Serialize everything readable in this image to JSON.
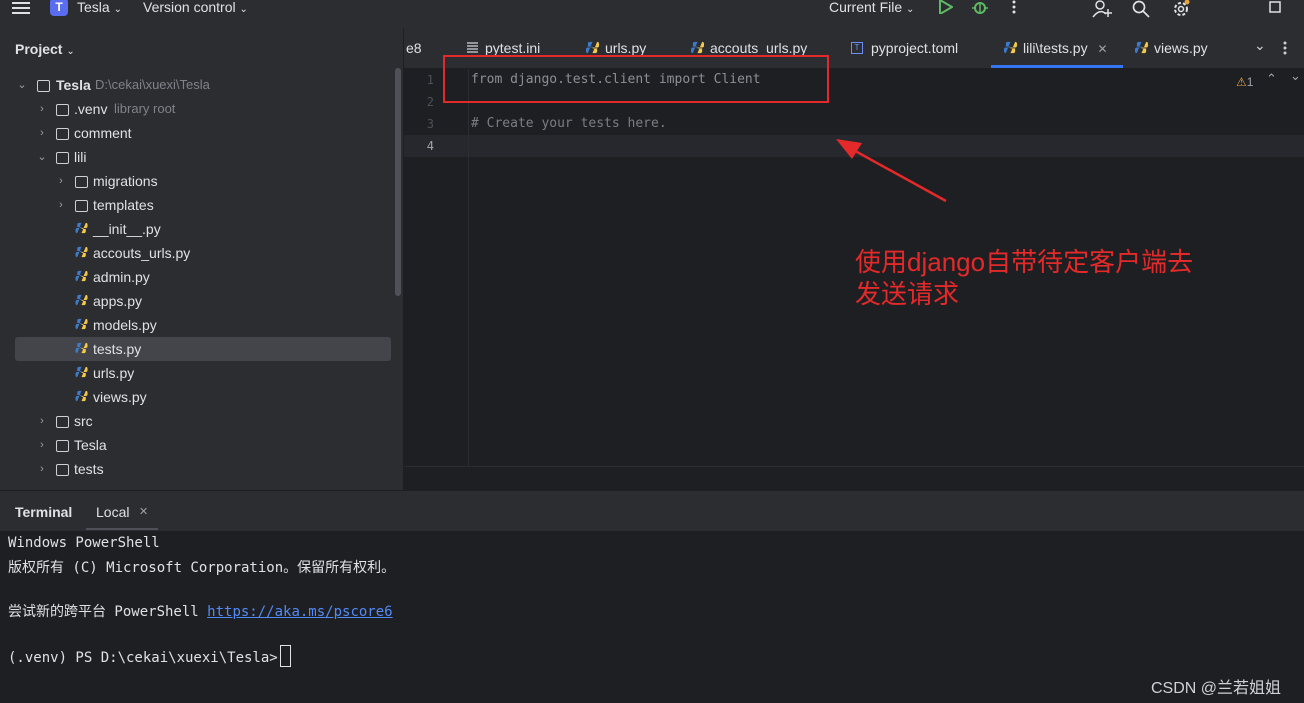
{
  "titlebar": {
    "project_badge": "T",
    "project_name": "Tesla",
    "vcs": "Version control",
    "run_config": "Current File",
    "icons": [
      "hamburger-icon",
      "run-icon",
      "debug-icon",
      "more-icon",
      "add-user-icon",
      "search-icon",
      "settings-icon",
      "window-icon"
    ]
  },
  "project": {
    "title": "Project",
    "root": {
      "name": "Tesla",
      "path": "D:\\cekai\\xuexi\\Tesla"
    },
    "items": [
      {
        "label": "Tesla",
        "hint": "D:\\cekai\\xuexi\\Tesla"
      },
      {
        "label": ".venv",
        "hint": "library root"
      },
      {
        "label": "comment"
      },
      {
        "label": "lili"
      },
      {
        "label": "migrations"
      },
      {
        "label": "templates"
      },
      {
        "label": "__init__.py"
      },
      {
        "label": "accouts_urls.py"
      },
      {
        "label": "admin.py"
      },
      {
        "label": "apps.py"
      },
      {
        "label": "models.py"
      },
      {
        "label": "tests.py"
      },
      {
        "label": "urls.py"
      },
      {
        "label": "views.py"
      },
      {
        "label": "src"
      },
      {
        "label": "Tesla"
      },
      {
        "label": "tests"
      }
    ]
  },
  "tabs": [
    {
      "label": "e8"
    },
    {
      "label": "pytest.ini"
    },
    {
      "label": "urls.py"
    },
    {
      "label": "accouts_urls.py"
    },
    {
      "label": "pyproject.toml"
    },
    {
      "label": "lili\\tests.py",
      "active": true
    },
    {
      "label": "views.py"
    }
  ],
  "editor": {
    "warnings": "1",
    "lines": [
      {
        "num": "1",
        "text": "from django.test.client import Client"
      },
      {
        "num": "2",
        "text": ""
      },
      {
        "num": "3",
        "text": "# Create your tests here."
      },
      {
        "num": "4",
        "text": ""
      }
    ]
  },
  "annotation": {
    "text_line1": "使用django自带待定客户端去",
    "text_line2": "发送请求",
    "color": "#e32929"
  },
  "terminal": {
    "tab_title": "Terminal",
    "session": "Local",
    "lines": [
      "Windows PowerShell",
      "版权所有 (C) Microsoft Corporation。保留所有权利。",
      "",
      "尝试新的跨平台 PowerShell ",
      "",
      "(.venv) PS D:\\cekai\\xuexi\\Tesla>"
    ],
    "link": "https://aka.ms/pscore6"
  },
  "watermark": "CSDN @兰若姐姐"
}
